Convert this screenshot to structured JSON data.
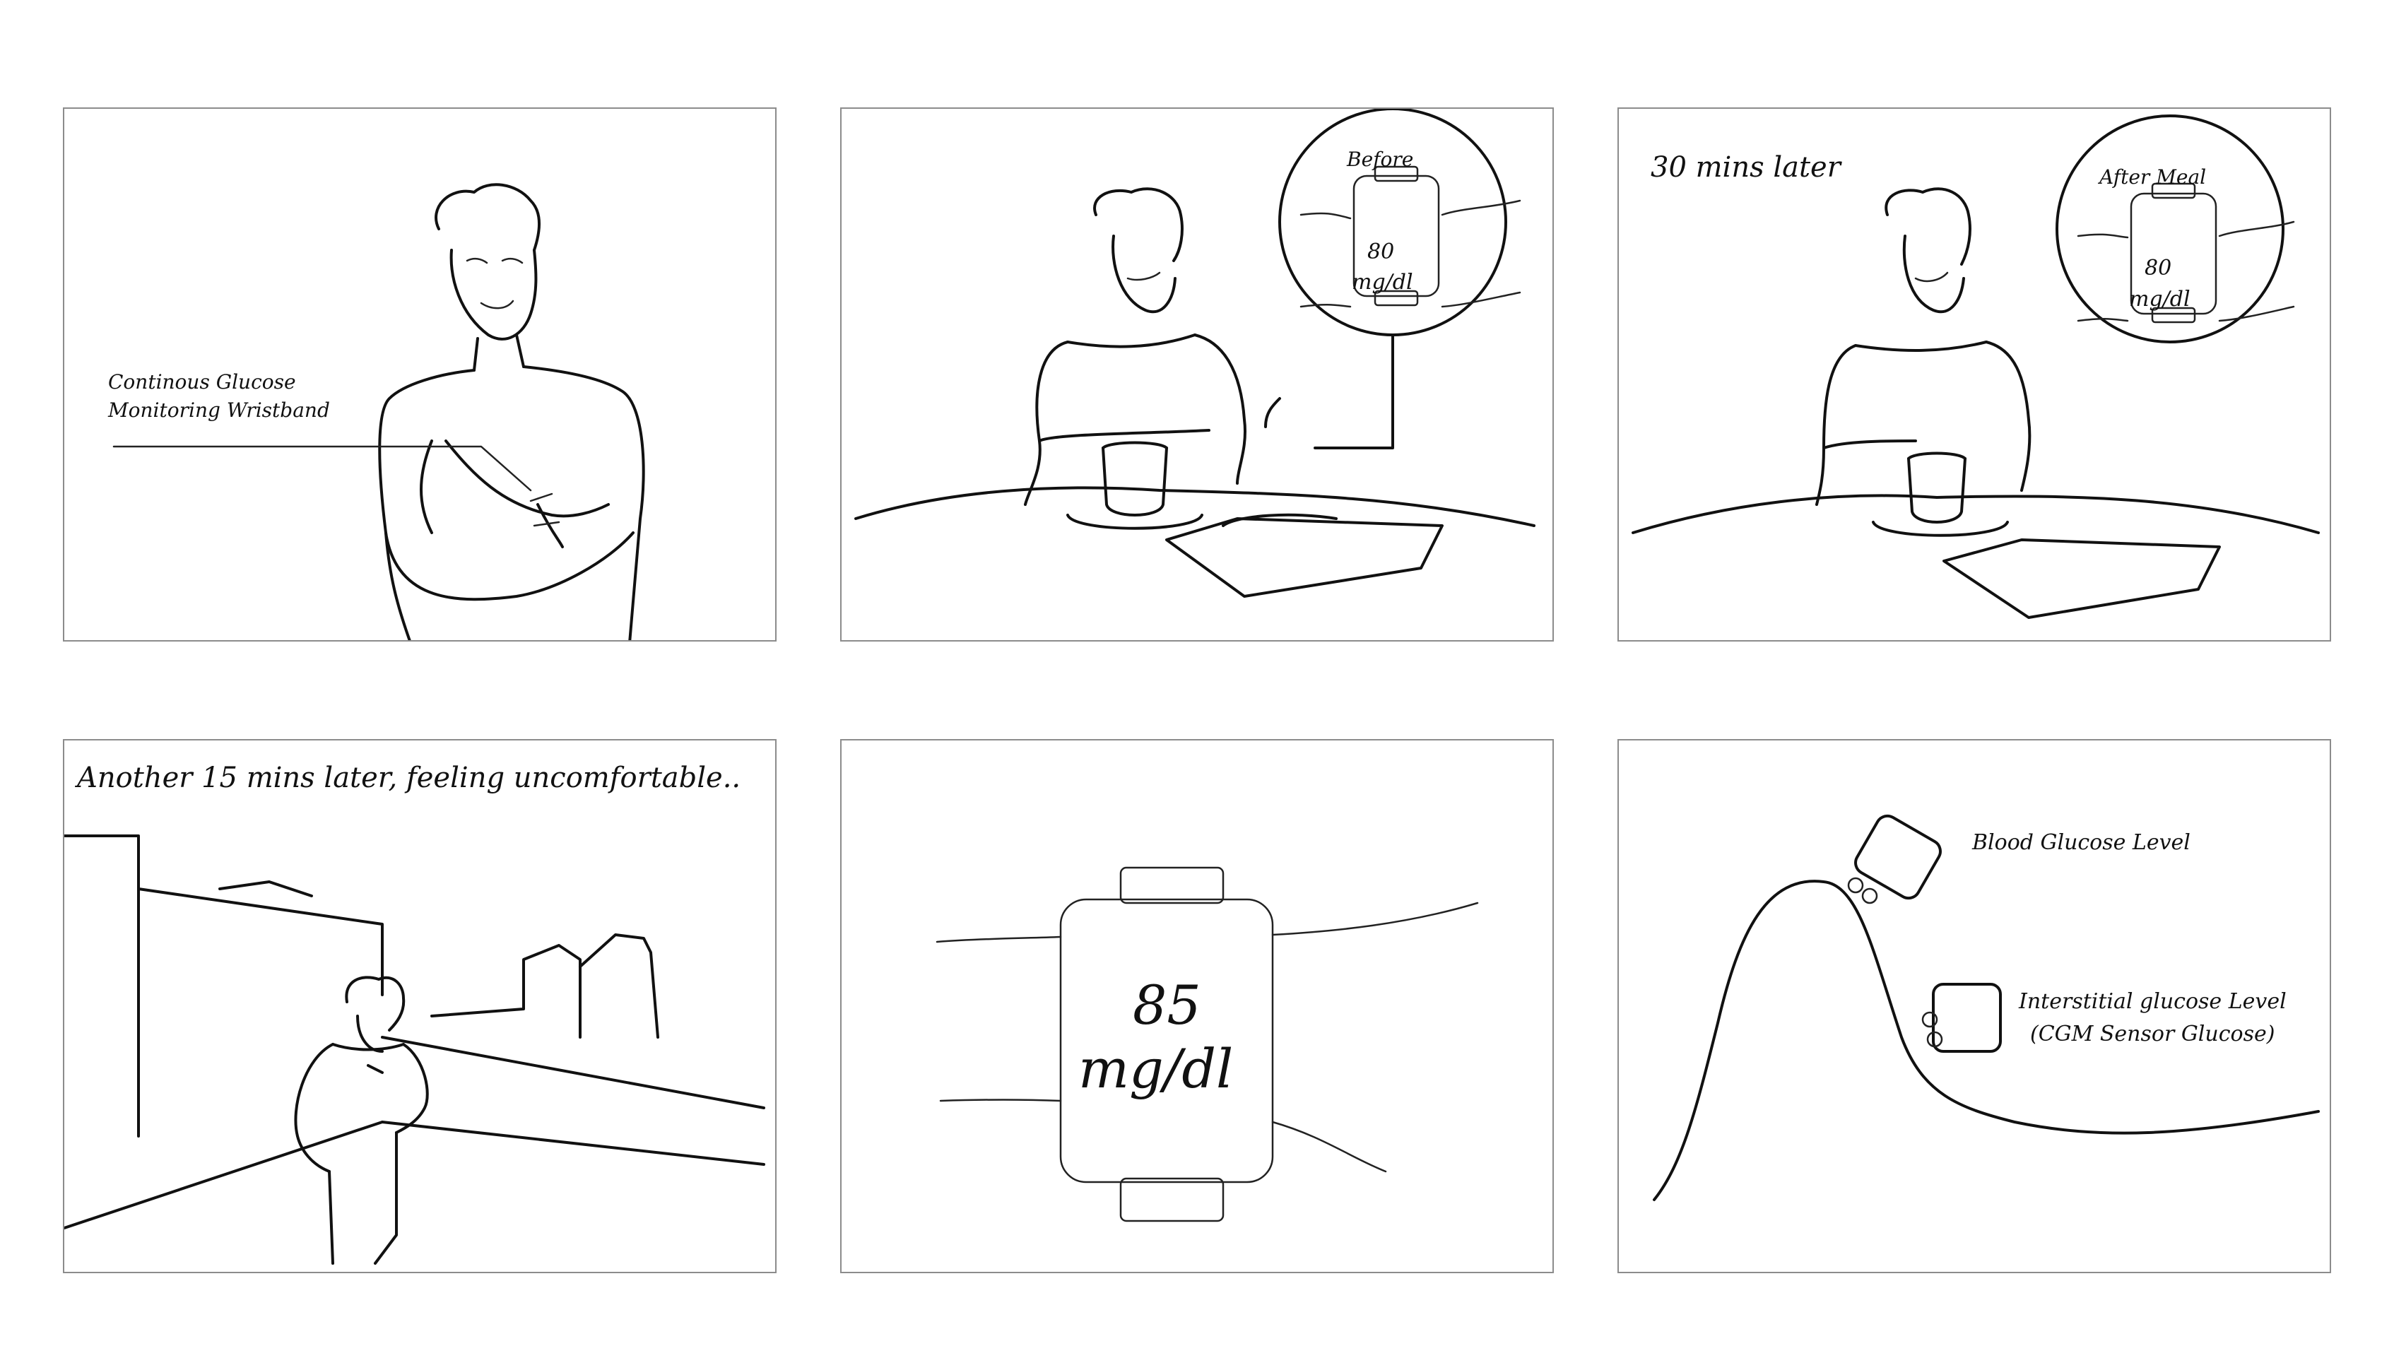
{
  "panels": [
    {
      "id": "p1",
      "annotation_line1": "Continous Glucose",
      "annotation_line2": "Monitoring Wristband"
    },
    {
      "id": "p2",
      "callout_label": "Before",
      "reading_value": "80",
      "reading_unit": "mg/dl"
    },
    {
      "id": "p3",
      "caption": "30 mins later",
      "callout_label": "After Meal",
      "reading_value": "80",
      "reading_unit": "mg/dl"
    },
    {
      "id": "p4",
      "caption": "Another 15 mins later, feeling uncomfortable.."
    },
    {
      "id": "p5",
      "reading_value": "85",
      "reading_unit": "mg/dl"
    },
    {
      "id": "p6",
      "label_blood": "Blood Glucose Level",
      "label_interstitial_line1": "Interstitial glucose Level",
      "label_interstitial_line2": "(CGM Sensor Glucose)"
    }
  ],
  "colors": {
    "ink": "#111111",
    "frame": "#8c8c8c",
    "background": "#ffffff"
  }
}
